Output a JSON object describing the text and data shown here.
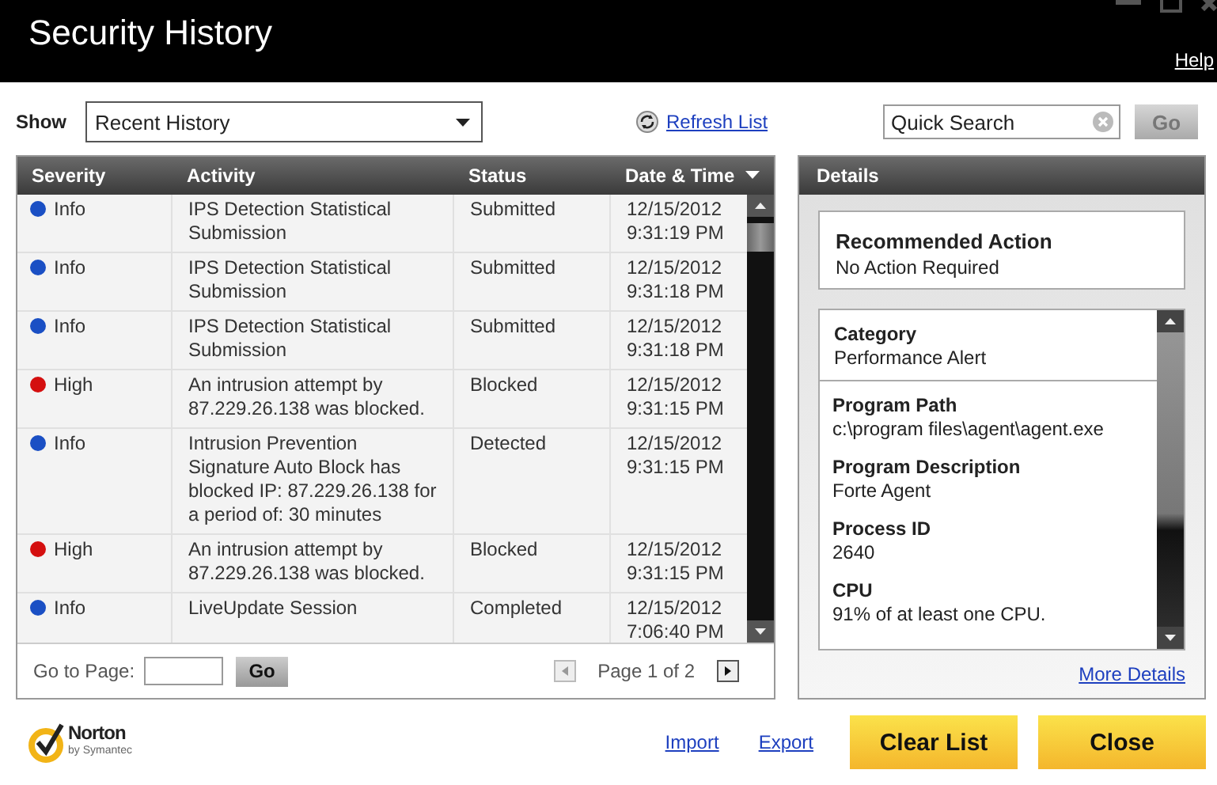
{
  "window": {
    "title": "Security History",
    "help": "Help"
  },
  "toolbar": {
    "show_label": "Show",
    "show_value": "Recent History",
    "refresh": "Refresh List",
    "search": {
      "placeholder": "Quick Search"
    },
    "go": "Go"
  },
  "table": {
    "columns": [
      "Severity",
      "Activity",
      "Status",
      "Date & Time"
    ],
    "rows": [
      {
        "severity": "Info",
        "color": "#1a4fc4",
        "activity": "IPS Detection Statistical Submission",
        "status": "Submitted",
        "date": "12/15/2012",
        "time": "9:31:19 PM"
      },
      {
        "severity": "Info",
        "color": "#1a4fc4",
        "activity": "IPS Detection Statistical Submission",
        "status": "Submitted",
        "date": "12/15/2012",
        "time": "9:31:18 PM"
      },
      {
        "severity": "Info",
        "color": "#1a4fc4",
        "activity": "IPS Detection Statistical Submission",
        "status": "Submitted",
        "date": "12/15/2012",
        "time": "9:31:18 PM"
      },
      {
        "severity": "High",
        "color": "#d40f0f",
        "activity": "An intrusion attempt by 87.229.26.138 was blocked.",
        "status": "Blocked",
        "date": "12/15/2012",
        "time": "9:31:15 PM"
      },
      {
        "severity": "Info",
        "color": "#1a4fc4",
        "activity": "Intrusion Prevention Signature Auto Block has blocked IP: 87.229.26.138 for a period of: 30 minutes",
        "status": "Detected",
        "date": "12/15/2012",
        "time": "9:31:15 PM"
      },
      {
        "severity": "High",
        "color": "#d40f0f",
        "activity": "An intrusion attempt by 87.229.26.138 was blocked.",
        "status": "Blocked",
        "date": "12/15/2012",
        "time": "9:31:15 PM"
      },
      {
        "severity": "Info",
        "color": "#1a4fc4",
        "activity": "LiveUpdate Session",
        "status": "Completed",
        "date": "12/15/2012",
        "time": "7:06:40 PM"
      }
    ],
    "go_to_page": "Go to Page:",
    "go": "Go",
    "page": "Page 1 of 2"
  },
  "details": {
    "title": "Details",
    "recommended_title": "Recommended Action",
    "recommended_value": "No Action Required",
    "items": [
      {
        "label": "Category",
        "value": "Performance Alert"
      },
      {
        "label": "Program Path",
        "value": "c:\\program files\\agent\\agent.exe"
      },
      {
        "label": "Program Description",
        "value": "Forte Agent"
      },
      {
        "label": "Process ID",
        "value": "2640"
      },
      {
        "label": "CPU",
        "value": "91% of at least one CPU."
      }
    ],
    "more": "More Details"
  },
  "footer": {
    "logo": "Norton",
    "logo_sub": "by Symantec",
    "import": "Import",
    "export": "Export",
    "clear": "Clear List",
    "close": "Close"
  }
}
